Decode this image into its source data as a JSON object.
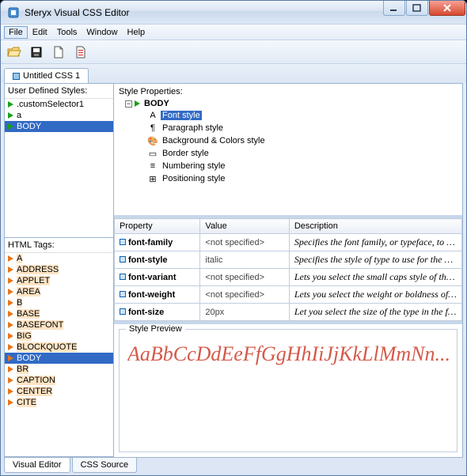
{
  "window": {
    "title": "Sferyx Visual CSS Editor"
  },
  "menu": {
    "file": "File",
    "edit": "Edit",
    "tools": "Tools",
    "window": "Window",
    "help": "Help"
  },
  "docTab": {
    "label": "Untitled CSS 1"
  },
  "userStyles": {
    "title": "User Defined Styles:",
    "items": [
      {
        "label": ".customSelector1"
      },
      {
        "label": "a"
      },
      {
        "label": "BODY"
      }
    ]
  },
  "htmlTags": {
    "title": "HTML Tags:",
    "items": [
      "A",
      "ADDRESS",
      "APPLET",
      "AREA",
      "B",
      "BASE",
      "BASEFONT",
      "BIG",
      "BLOCKQUOTE",
      "BODY",
      "BR",
      "CAPTION",
      "CENTER",
      "CITE"
    ]
  },
  "styleProps": {
    "title": "Style Properties:",
    "root": "BODY",
    "children": [
      "Font style",
      "Paragraph style",
      "Background & Colors style",
      "Border style",
      "Numbering style",
      "Positioning style"
    ]
  },
  "propTable": {
    "cols": {
      "p": "Property",
      "v": "Value",
      "d": "Description"
    },
    "rows": [
      {
        "p": "font-family",
        "v": "<not specified>",
        "d": "Specifies the font family, or typeface, to us..."
      },
      {
        "p": "font-style",
        "v": "italic",
        "d": "Specifies the style of type to use for the ele..."
      },
      {
        "p": "font-variant",
        "v": "<not specified>",
        "d": "Lets you select the small caps style of the t..."
      },
      {
        "p": "font-weight",
        "v": "<not specified>",
        "d": "Lets you select the weight or boldness of th..."
      },
      {
        "p": "font-size",
        "v": "20px",
        "d": "Let you select the size of the type in the font"
      }
    ]
  },
  "preview": {
    "title": "Style Preview",
    "sample": "AaBbCcDdEeFfGgHhIiJjKkLlMmNn..."
  },
  "bottomTabs": {
    "visual": "Visual Editor",
    "source": "CSS Source"
  }
}
